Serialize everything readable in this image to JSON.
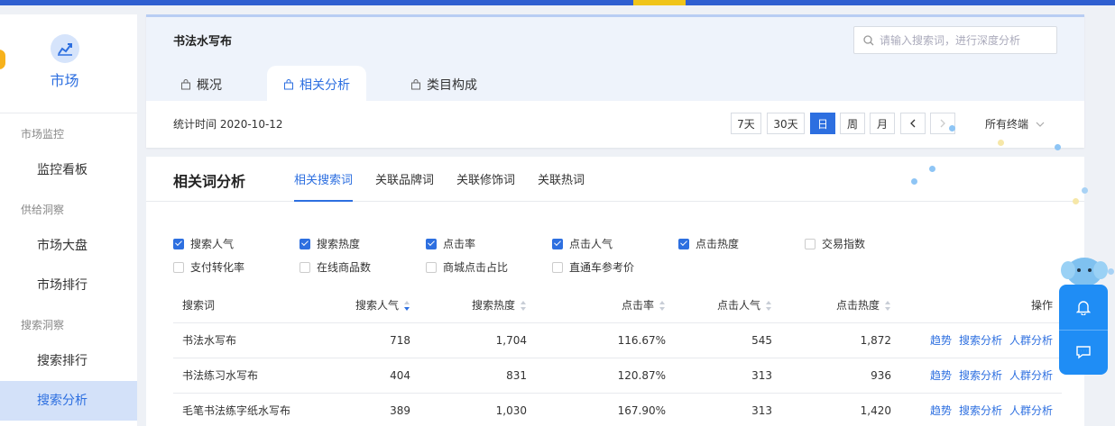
{
  "sidebar": {
    "title": "市场",
    "groups": [
      "市场监控",
      "供给洞察",
      "搜索洞察"
    ],
    "items": [
      "监控看板",
      "市场大盘",
      "市场排行",
      "搜索排行",
      "搜索分析"
    ]
  },
  "header": {
    "title": "书法水写布",
    "search_placeholder": "请输入搜索词，进行深度分析",
    "tabs": [
      "概况",
      "相关分析",
      "类目构成"
    ],
    "stat_time": "统计时间 2020-10-12",
    "period_buttons": [
      "7天",
      "30天",
      "日",
      "周",
      "月"
    ],
    "active_period": "日",
    "terminal": "所有终端"
  },
  "main": {
    "title": "相关词分析",
    "subtabs": [
      "相关搜索词",
      "关联品牌词",
      "关联修饰词",
      "关联热词"
    ],
    "checkboxes": [
      {
        "label": "搜索人气",
        "checked": true
      },
      {
        "label": "搜索热度",
        "checked": true
      },
      {
        "label": "点击率",
        "checked": true
      },
      {
        "label": "点击人气",
        "checked": true
      },
      {
        "label": "点击热度",
        "checked": true
      },
      {
        "label": "交易指数",
        "checked": false
      },
      {
        "label": "支付转化率",
        "checked": false
      },
      {
        "label": "在线商品数",
        "checked": false
      },
      {
        "label": "商城点击占比",
        "checked": false
      },
      {
        "label": "直通车参考价",
        "checked": false
      }
    ],
    "columns": [
      "搜索词",
      "搜索人气",
      "搜索热度",
      "点击率",
      "点击人气",
      "点击热度",
      "操作"
    ],
    "rows": [
      {
        "word": "书法水写布",
        "pop": "718",
        "heat": "1,704",
        "ctr": "116.67%",
        "cpop": "545",
        "cheat": "1,872"
      },
      {
        "word": "书法练习水写布",
        "pop": "404",
        "heat": "831",
        "ctr": "120.87%",
        "cpop": "313",
        "cheat": "936"
      },
      {
        "word": "毛笔书法练字纸水写布",
        "pop": "389",
        "heat": "1,030",
        "ctr": "167.90%",
        "cpop": "313",
        "cheat": "1,420"
      }
    ],
    "row_actions": [
      "趋势",
      "搜索分析",
      "人群分析"
    ]
  },
  "colors": {
    "primary": "#2d6fe0",
    "topbar": "#2f5fd0",
    "float": "#1f8df5"
  }
}
